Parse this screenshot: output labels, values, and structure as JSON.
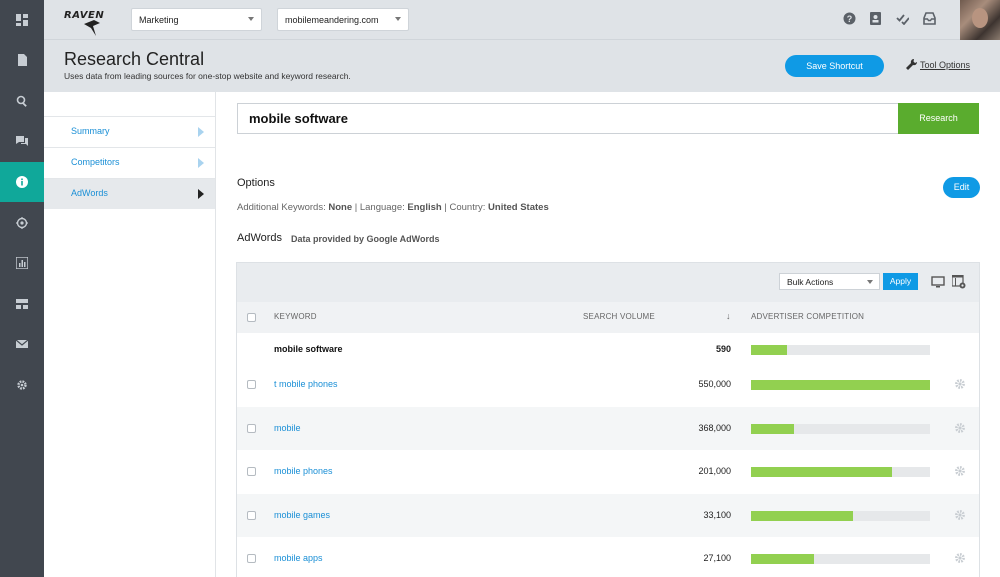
{
  "logo": "RAVEN",
  "topbar": {
    "account_select": "Marketing",
    "site_select": "mobilemeandering.com"
  },
  "header": {
    "title": "Research Central",
    "subtitle": "Uses data from leading sources for one-stop website and keyword research.",
    "save_shortcut": "Save Shortcut",
    "tool_options": "Tool Options"
  },
  "subnav": [
    {
      "label": "Summary"
    },
    {
      "label": "Competitors"
    },
    {
      "label": "AdWords"
    }
  ],
  "search": {
    "value": "mobile software",
    "button": "Research"
  },
  "options": {
    "title": "Options",
    "additional_label": "Additional Keywords:",
    "additional_value": "None",
    "language_label": "Language:",
    "language_value": "English",
    "country_label": "Country:",
    "country_value": "United States",
    "sep": "|",
    "edit": "Edit"
  },
  "adwords": {
    "title": "AdWords",
    "subtitle": "Data provided by Google AdWords"
  },
  "toolbar": {
    "bulk_actions": "Bulk Actions",
    "apply": "Apply"
  },
  "table": {
    "headers": {
      "keyword": "KEYWORD",
      "volume": "SEARCH VOLUME",
      "sort": "↓",
      "competition": "ADVERTISER COMPETITION"
    },
    "rows": [
      {
        "keyword": "mobile software",
        "volume": "590",
        "competition": 0.2
      },
      {
        "keyword": "t mobile phones",
        "volume": "550,000",
        "competition": 1.0
      },
      {
        "keyword": "mobile",
        "volume": "368,000",
        "competition": 0.24
      },
      {
        "keyword": "mobile phones",
        "volume": "201,000",
        "competition": 0.79
      },
      {
        "keyword": "mobile games",
        "volume": "33,100",
        "competition": 0.57
      },
      {
        "keyword": "mobile apps",
        "volume": "27,100",
        "competition": 0.35
      }
    ]
  },
  "colors": {
    "rail": "#41474f",
    "rail_active": "#10a89a",
    "accent_blue": "#0f9ae5",
    "research_green": "#5aac2e",
    "bar_green": "#92d050"
  }
}
